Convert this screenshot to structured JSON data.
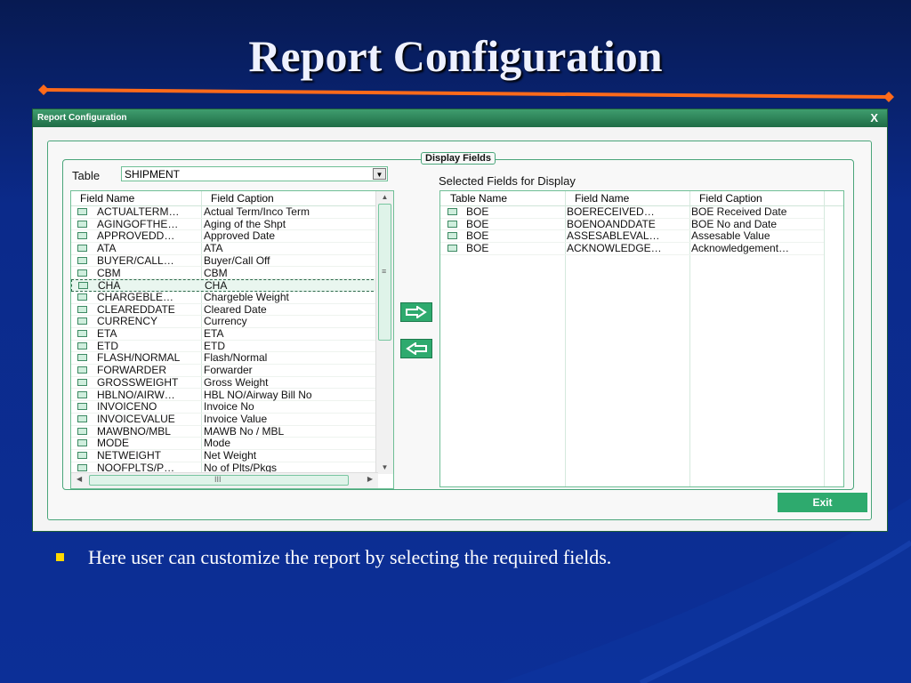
{
  "slide": {
    "title": "Report Configuration",
    "bullet": "Here user can customize the report by selecting the required fields."
  },
  "window": {
    "title": "Report Configuration",
    "close_label": "X",
    "group_title": "Display Fields",
    "table_label": "Table",
    "table_value": "SHIPMENT",
    "selected_label": "Selected Fields for Display",
    "exit_label": "Exit",
    "left_headers": {
      "field_name": "Field Name",
      "field_caption": "Field Caption"
    },
    "right_headers": {
      "table_name": "Table Name",
      "field_name": "Field Name",
      "field_caption": "Field Caption"
    },
    "left_rows": [
      {
        "field": "ACTUALTERM…",
        "caption": "Actual Term/Inco Term"
      },
      {
        "field": "AGINGOFTHE…",
        "caption": "Aging of the Shpt"
      },
      {
        "field": "APPROVEDD…",
        "caption": "Approved Date"
      },
      {
        "field": "ATA",
        "caption": "ATA"
      },
      {
        "field": "BUYER/CALL…",
        "caption": "Buyer/Call Off"
      },
      {
        "field": "CBM",
        "caption": "CBM"
      },
      {
        "field": "CHA",
        "caption": "CHA"
      },
      {
        "field": "CHARGEBLE…",
        "caption": "Chargeble Weight"
      },
      {
        "field": "CLEAREDDATE",
        "caption": "Cleared Date"
      },
      {
        "field": "CURRENCY",
        "caption": "Currency"
      },
      {
        "field": "ETA",
        "caption": "ETA"
      },
      {
        "field": "ETD",
        "caption": "ETD"
      },
      {
        "field": "FLASH/NORMAL",
        "caption": "Flash/Normal"
      },
      {
        "field": "FORWARDER",
        "caption": "Forwarder"
      },
      {
        "field": "GROSSWEIGHT",
        "caption": "Gross Weight"
      },
      {
        "field": "HBLNO/AIRW…",
        "caption": "HBL NO/Airway Bill No"
      },
      {
        "field": "INVOICENO",
        "caption": "Invoice No"
      },
      {
        "field": "INVOICEVALUE",
        "caption": "Invoice Value"
      },
      {
        "field": "MAWBNO/MBL",
        "caption": "MAWB No / MBL"
      },
      {
        "field": "MODE",
        "caption": "Mode"
      },
      {
        "field": "NETWEIGHT",
        "caption": "Net Weight"
      },
      {
        "field": "NOOFPLTS/P…",
        "caption": "No of Plts/Pkgs"
      }
    ],
    "right_rows": [
      {
        "table": "BOE",
        "field": "BOERECEIVED…",
        "caption": "BOE Received Date"
      },
      {
        "table": "BOE",
        "field": "BOENOANDDATE",
        "caption": "BOE No and Date"
      },
      {
        "table": "BOE",
        "field": "ASSESABLEVAL…",
        "caption": "Assesable Value"
      },
      {
        "table": "BOE",
        "field": "ACKNOWLEDGE…",
        "caption": "Acknowledgement…"
      }
    ]
  },
  "colors": {
    "accent_green": "#2eaa6e",
    "title_rule": "#ff6a1a",
    "background": "#0c2f97"
  },
  "icons": {
    "move_right": "arrow-right-icon",
    "move_left": "arrow-left-icon"
  }
}
